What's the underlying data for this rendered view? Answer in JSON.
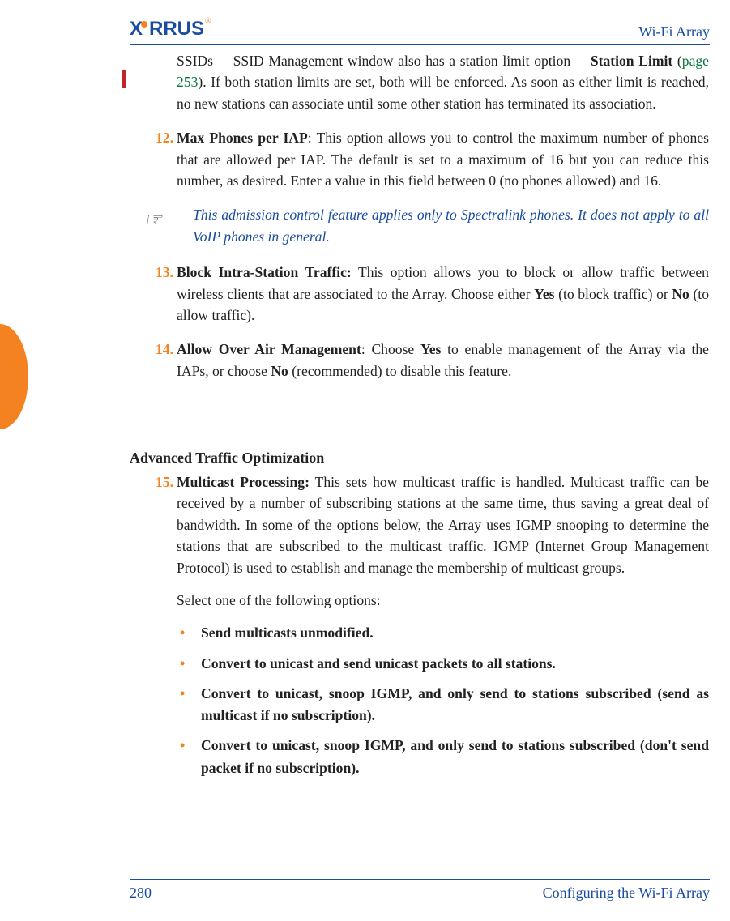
{
  "header": {
    "brand_prefix": "X",
    "brand_rest": "RRUS",
    "title": "Wi-Fi Array"
  },
  "footer": {
    "page_number": "280",
    "section": "Configuring the Wi-Fi Array"
  },
  "body": {
    "continuation": {
      "pre": "SSIDs — SSID Management window also has a station limit option — ",
      "bold": "Station Limit",
      "mid": " (",
      "link": "page 253",
      "post": "). If both station limits are set, both will be enforced. As soon as either limit is reached, no new stations can associate until some other station has terminated its association."
    },
    "item12": {
      "num": "12.",
      "title": "Max Phones per IAP",
      "text": ": This option allows you to control the maximum number of phones that are allowed per IAP. The default is set to a maximum of 16 but you can reduce this number, as desired. Enter a value in this field between 0 (no phones allowed) and 16."
    },
    "note": "This admission control feature applies only to Spectralink phones. It does not apply to all VoIP phones in general.",
    "item13": {
      "num": "13.",
      "title": "Block Intra-Station Traffic:",
      "text_before_yes": " This option allows you to block or allow traffic between wireless clients that are associated to the Array. Choose either ",
      "yes": "Yes",
      "mid": " (to block traffic) or ",
      "no": "No",
      "after": " (to allow traffic)."
    },
    "item14": {
      "num": "14.",
      "title": "Allow Over Air Management",
      "pre": ": Choose ",
      "yes": "Yes",
      "mid": " to enable management of the Array via the IAPs, or choose ",
      "no": "No",
      "after": " (recommended) to disable this feature."
    },
    "section_heading": "Advanced Traffic Optimization",
    "item15": {
      "num": "15.",
      "title": "Multicast Processing:",
      "para1": " This sets how multicast traffic is handled. Multicast traffic can be received by a number of subscribing stations at the same time, thus saving a great deal of bandwidth. In some of the options below, the Array uses IGMP snooping to determine the stations that are subscribed to the multicast traffic. IGMP (Internet Group Management Protocol) is used to establish and manage the membership of multicast groups.",
      "para2": "Select one of the following options:",
      "opts": [
        "Send multicasts unmodified.",
        "Convert to unicast and send unicast packets to all stations.",
        "Convert to unicast, snoop IGMP, and only send to stations subscribed (send as multicast if no subscription).",
        "Convert to unicast, snoop IGMP, and only send to stations subscribed (don't send packet if no subscription)."
      ]
    }
  }
}
